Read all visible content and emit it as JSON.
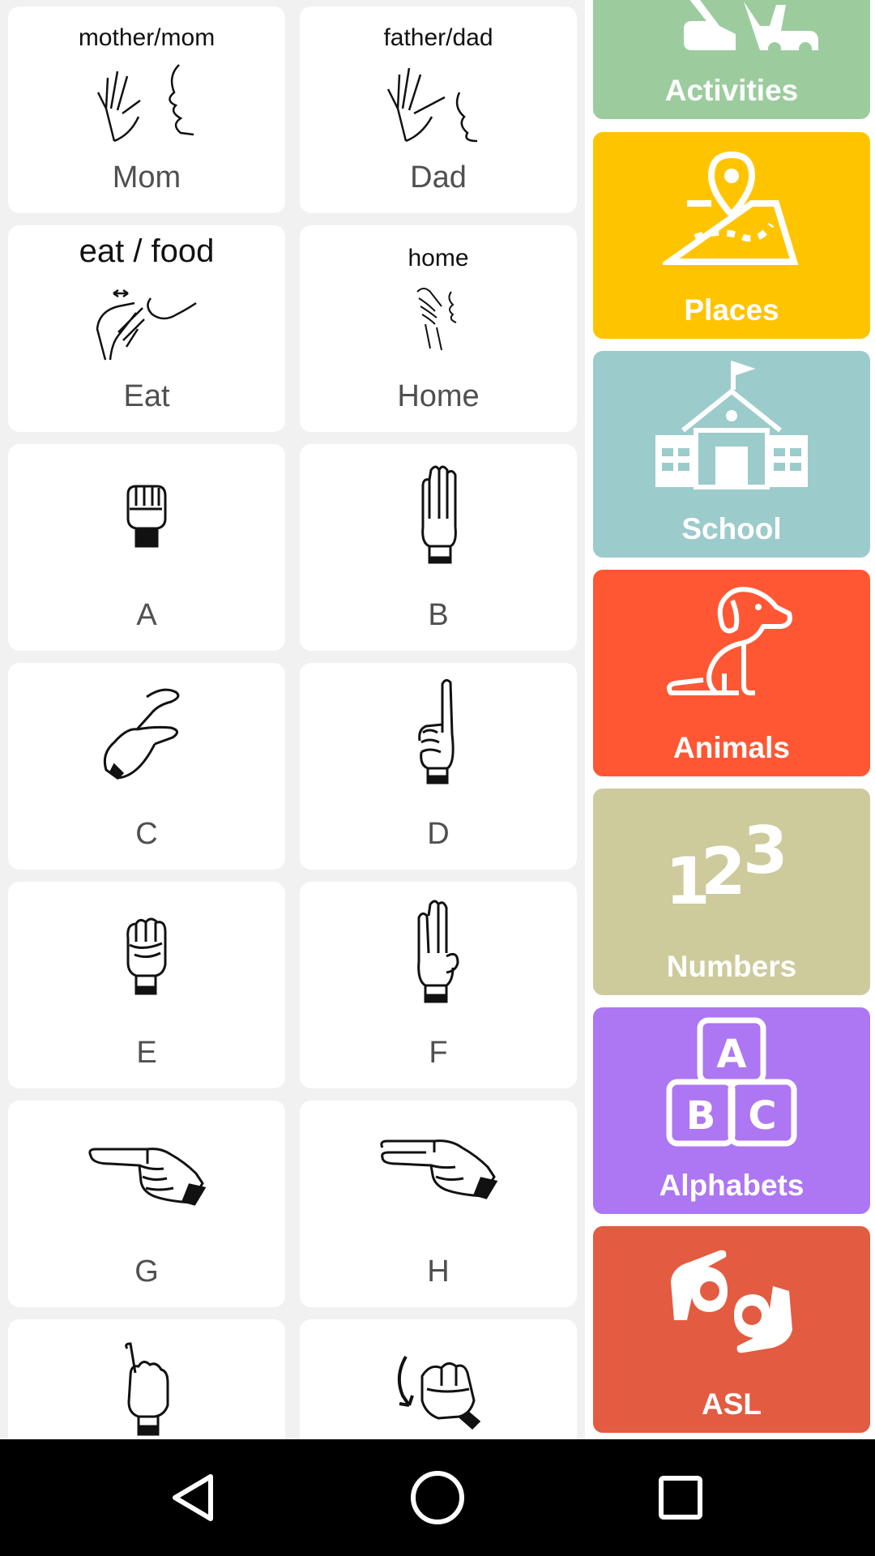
{
  "signs": [
    {
      "caption": "Mom",
      "top_text": "mother/mom"
    },
    {
      "caption": "Dad",
      "top_text": "father/dad"
    },
    {
      "caption": "Eat",
      "top_text": "eat / food"
    },
    {
      "caption": "Home",
      "top_text": "home"
    },
    {
      "caption": "A",
      "top_text": ""
    },
    {
      "caption": "B",
      "top_text": ""
    },
    {
      "caption": "C",
      "top_text": ""
    },
    {
      "caption": "D",
      "top_text": ""
    },
    {
      "caption": "E",
      "top_text": ""
    },
    {
      "caption": "F",
      "top_text": ""
    },
    {
      "caption": "G",
      "top_text": ""
    },
    {
      "caption": "H",
      "top_text": ""
    },
    {
      "caption": "",
      "top_text": ""
    },
    {
      "caption": "",
      "top_text": ""
    }
  ],
  "categories": [
    {
      "label": "Activities",
      "color": "#9ccc9e",
      "icon": "activities-icon"
    },
    {
      "label": "Places",
      "color": "#ffc400",
      "icon": "map-pin-icon"
    },
    {
      "label": "School",
      "color": "#9ccbcb",
      "icon": "school-building-icon"
    },
    {
      "label": "Animals",
      "color": "#ff5733",
      "icon": "dog-icon"
    },
    {
      "label": "Numbers",
      "color": "#cdca9c",
      "icon": "numbers-123-icon"
    },
    {
      "label": "Alphabets",
      "color": "#ad76f2",
      "icon": "abc-blocks-icon"
    },
    {
      "label": "ASL",
      "color": "#e35b40",
      "icon": "sign-language-hands-icon"
    }
  ],
  "navbar": {
    "back": "back-triangle-icon",
    "home": "home-circle-icon",
    "recents": "recents-square-icon"
  }
}
